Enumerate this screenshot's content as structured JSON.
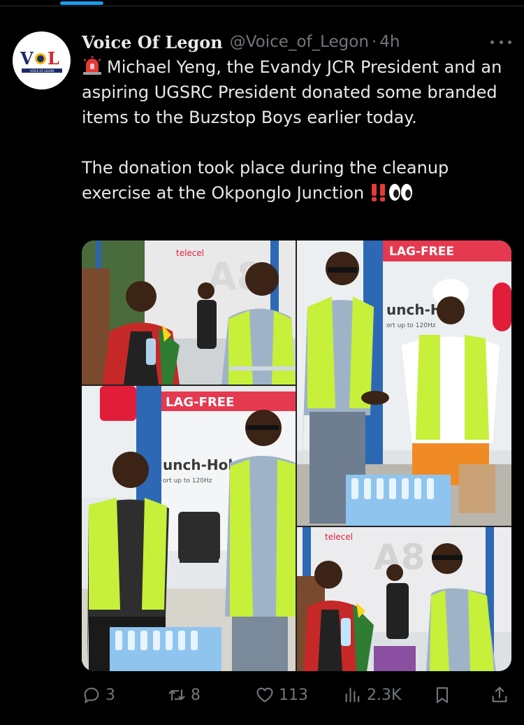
{
  "author": {
    "name": "Voice Of Legon",
    "handle": "@Voice_of_Legon",
    "separator": "·",
    "time": "4h",
    "avatar_text": "VOL",
    "avatar_subtext": "VOICE OF LEGON"
  },
  "tweet": {
    "paragraph1": "Michael Yeng, the Evandy JCR President and an aspiring UGSRC President donated some branded items to the Buzstop Boys earlier today.",
    "paragraph2": "The donation took place during the cleanup exercise at the Okponglo Junction",
    "emojis": [
      "siren-emoji",
      "double-exclamation-emoji",
      "eyes-emoji"
    ]
  },
  "media": {
    "photos": [
      {
        "name": "photo-1",
        "banner": "telecel",
        "billboard": "A8"
      },
      {
        "name": "photo-2",
        "banner": "LAG-FREE",
        "sign_text": "unch-H",
        "sign_sub": "ort up to 120Hz"
      },
      {
        "name": "photo-3",
        "banner": "LAG-FREE",
        "sign_text": "unch-Hole",
        "sign_sub": "ort up to 120Hz"
      },
      {
        "name": "photo-4",
        "banner": "telecel",
        "billboard": "A8"
      }
    ]
  },
  "actions": {
    "replies": "3",
    "retweets": "8",
    "likes": "113",
    "views": "2.3K"
  },
  "colors": {
    "background": "#000000",
    "text": "#e7e9ea",
    "muted": "#71767b",
    "accent": "#1d9bf0",
    "vest": "#c6f03a"
  }
}
